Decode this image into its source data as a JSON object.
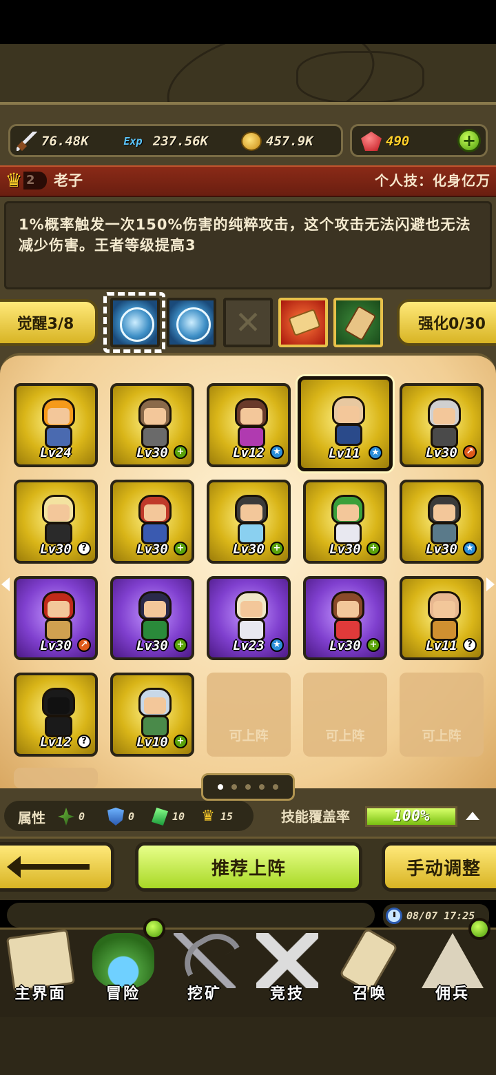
{
  "resources": {
    "attack": "76.48K",
    "exp_label": "Exp",
    "exp": "237.56K",
    "gold": "457.9K",
    "gems": "490"
  },
  "hero": {
    "rank": "2",
    "name": "老子",
    "skill": "个人技：化身亿万",
    "description": "1%概率触发一次150%伤害的纯粹攻击，这个攻击无法闪避也无法减少伤害。王者等级提高3"
  },
  "awaken_label": "觉醒3/8",
  "strengthen_label": "强化0/30",
  "roster": [
    {
      "level": "Lv24",
      "frame": "gold",
      "badge": "",
      "hair": "#f59a1a",
      "shirt": "#4a6ab0"
    },
    {
      "level": "Lv30",
      "frame": "gold",
      "badge": "plus",
      "hair": "#8a6a4a",
      "shirt": "#6a6a6a"
    },
    {
      "level": "Lv12",
      "frame": "gold",
      "badge": "star",
      "hair": "#6a3a2a",
      "shirt": "#b03ab0"
    },
    {
      "level": "Lv11",
      "frame": "gold",
      "badge": "star",
      "hair": "#e8c8a0",
      "shirt": "#2a4a8a",
      "selected": true
    },
    {
      "level": "Lv30",
      "frame": "gold",
      "badge": "o",
      "hair": "#d0d0d0",
      "shirt": "#4a4a4a"
    },
    {
      "level": "Lv30",
      "frame": "gold",
      "badge": "q",
      "hair": "#f3e3a0",
      "shirt": "#2a2a2a"
    },
    {
      "level": "Lv30",
      "frame": "gold",
      "badge": "plus",
      "hair": "#c03a2a",
      "shirt": "#3a5ab0"
    },
    {
      "level": "Lv30",
      "frame": "gold",
      "badge": "plus",
      "hair": "#3a3a3a",
      "shirt": "#8ad0f0"
    },
    {
      "level": "Lv30",
      "frame": "gold",
      "badge": "plus",
      "hair": "#3aa03a",
      "shirt": "#e8e8f0"
    },
    {
      "level": "Lv30",
      "frame": "gold",
      "badge": "star",
      "hair": "#3a3a3a",
      "shirt": "#5a7a8a"
    },
    {
      "level": "Lv30",
      "frame": "purple",
      "badge": "o",
      "hair": "#c02a1a",
      "shirt": "#d0a050"
    },
    {
      "level": "Lv30",
      "frame": "purple",
      "badge": "plus",
      "hair": "#2a2a4a",
      "shirt": "#2a8a3a"
    },
    {
      "level": "Lv23",
      "frame": "purple",
      "badge": "star",
      "hair": "#f0e8c8",
      "shirt": "#e8e8f0"
    },
    {
      "level": "Lv30",
      "frame": "purple",
      "badge": "plus",
      "hair": "#8a4a2a",
      "shirt": "#e03a3a"
    },
    {
      "level": "Lv11",
      "frame": "gold",
      "badge": "q",
      "hair": "#e8b890",
      "shirt": "#d09030"
    },
    {
      "level": "Lv12",
      "frame": "gold",
      "badge": "q",
      "hair": "#1a1a1a",
      "shirt": "#1a1a1a"
    },
    {
      "level": "Lv10",
      "frame": "gold",
      "badge": "plus",
      "hair": "#c8d8e8",
      "shirt": "#4a8a4a"
    },
    {
      "empty": true,
      "label": "可上阵"
    },
    {
      "empty": true,
      "label": "可上阵"
    },
    {
      "empty": true,
      "label": "可上阵"
    }
  ],
  "stats": {
    "label": "属性",
    "nature": "0",
    "defense": "0",
    "gem": "10",
    "crown": "15",
    "coverage_label": "技能覆盖率",
    "coverage": "100%",
    "coverage_fraction": 1.0
  },
  "buttons": {
    "recommend": "推荐上阵",
    "manual": "手动调整"
  },
  "datetime": "08/07 17:25",
  "nav": [
    {
      "label": "主界面",
      "icon": "map-icon",
      "dot": false
    },
    {
      "label": "冒险",
      "icon": "island-icon",
      "dot": true
    },
    {
      "label": "挖矿",
      "icon": "pickaxe-icon",
      "dot": false
    },
    {
      "label": "竞技",
      "icon": "crossed-swords-icon",
      "dot": false
    },
    {
      "label": "召唤",
      "icon": "scroll-icon",
      "dot": false
    },
    {
      "label": "佣兵",
      "icon": "tent-icon",
      "dot": true
    }
  ]
}
